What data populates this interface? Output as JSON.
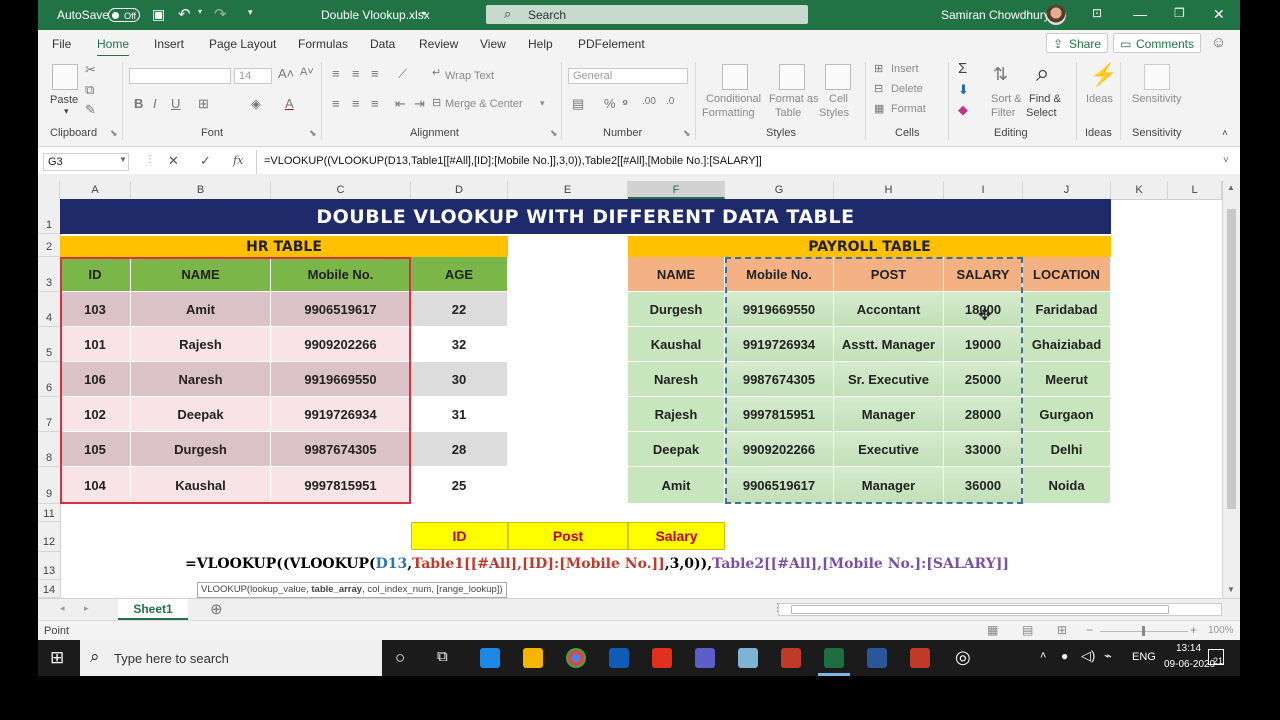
{
  "titlebar": {
    "autosave_label": "AutoSave",
    "autosave_state": "Off",
    "filename": "Double Vlookup.xlsx",
    "search_placeholder": "Search",
    "user_name": "Samiran Chowdhury"
  },
  "menu": {
    "tabs": [
      "File",
      "Home",
      "Insert",
      "Page Layout",
      "Formulas",
      "Data",
      "Review",
      "View",
      "Help",
      "PDFelement"
    ],
    "active": "Home",
    "share_label": "Share",
    "comments_label": "Comments"
  },
  "ribbon": {
    "clipboard": {
      "group": "Clipboard",
      "paste": "Paste"
    },
    "font": {
      "group": "Font",
      "size": "14"
    },
    "alignment": {
      "group": "Alignment",
      "wrap": "Wrap Text",
      "merge": "Merge & Center"
    },
    "number": {
      "group": "Number",
      "format": "General"
    },
    "styles": {
      "group": "Styles",
      "conditional1": "Conditional",
      "conditional2": "Formatting",
      "format_table1": "Format as",
      "format_table2": "Table",
      "cell_styles1": "Cell",
      "cell_styles2": "Styles"
    },
    "cells": {
      "group": "Cells",
      "insert": "Insert",
      "delete": "Delete",
      "format": "Format"
    },
    "editing": {
      "group": "Editing",
      "sort1": "Sort &",
      "sort2": "Filter",
      "find1": "Find &",
      "find2": "Select"
    },
    "ideas": {
      "group": "Ideas",
      "label": "Ideas"
    },
    "sensitivity": {
      "group": "Sensitivity",
      "label": "Sensitivity"
    }
  },
  "formula_bar": {
    "name_box": "G3",
    "fx": "fx",
    "formula": "=VLOOKUP((VLOOKUP(D13,Table1[[#All],[ID]:[Mobile No.]],3,0)),Table2[[#All],[Mobile No.]:[SALARY]]"
  },
  "columns": [
    "A",
    "B",
    "C",
    "D",
    "E",
    "F",
    "G",
    "H",
    "I",
    "J",
    "K",
    "L"
  ],
  "rows": [
    "1",
    "2",
    "3",
    "4",
    "5",
    "6",
    "7",
    "8",
    "9",
    "11",
    "12",
    "13",
    "14"
  ],
  "banner": "DOUBLE VLOOKUP WITH DIFFERENT DATA TABLE",
  "hr_table": {
    "title": "HR TABLE",
    "headers": [
      "ID",
      "NAME",
      "Mobile No.",
      "AGE"
    ],
    "rows": [
      [
        "103",
        "Amit",
        "9906519617",
        "22"
      ],
      [
        "101",
        "Rajesh",
        "9909202266",
        "32"
      ],
      [
        "106",
        "Naresh",
        "9919669550",
        "30"
      ],
      [
        "102",
        "Deepak",
        "9919726934",
        "31"
      ],
      [
        "105",
        "Durgesh",
        "9987674305",
        "28"
      ],
      [
        "104",
        "Kaushal",
        "9997815951",
        "25"
      ]
    ]
  },
  "payroll_table": {
    "title": "PAYROLL TABLE",
    "headers": [
      "NAME",
      "Mobile No.",
      "POST",
      "SALARY",
      "LOCATION"
    ],
    "rows": [
      [
        "Durgesh",
        "9919669550",
        "Accontant",
        "18000",
        "Faridabad"
      ],
      [
        "Kaushal",
        "9919726934",
        "Asstt. Manager",
        "19000",
        "Ghaiziabad"
      ],
      [
        "Naresh",
        "9987674305",
        "Sr. Executive",
        "25000",
        "Meerut"
      ],
      [
        "Rajesh",
        "9997815951",
        "Manager",
        "28000",
        "Gurgaon"
      ],
      [
        "Deepak",
        "9909202266",
        "Executive",
        "33000",
        "Delhi"
      ],
      [
        "Amit",
        "9906519617",
        "Manager",
        "36000",
        "Noida"
      ]
    ]
  },
  "lookup_headers": [
    "ID",
    "Post",
    "Salary"
  ],
  "cell_formula": {
    "p1": "=VLOOKUP((",
    "p2": "VLOOKUP(",
    "p3": "D13",
    "p4": ",",
    "p5": "Table1[[#All],[ID]:[Mobile No.]]",
    "p6": ",3,0))",
    "p7": ",",
    "p8": "Table2[[#All],[Mobile No.]:[SALARY]]"
  },
  "tooltip": {
    "fn": "VLOOKUP(lookup_value, ",
    "arg": "table_array",
    "rest": ", col_index_num, [range_lookup])"
  },
  "sheet_tab": "Sheet1",
  "status": {
    "mode": "Point",
    "zoom": "100%"
  },
  "taskbar": {
    "search_placeholder": "Type here to search",
    "lang": "ENG",
    "time": "13:14",
    "date": "09-06-2020",
    "notifications": "21"
  },
  "colors": {
    "excel_green": "#217346",
    "banner": "#1f2a6b",
    "section_yellow": "#ffc000",
    "hr_header": "#7ab648",
    "hr_row_odd": "#dbc2c9",
    "hr_row_even": "#f8e3e8",
    "payroll_header": "#f4b183",
    "payroll_row": "#c8e6be",
    "lookup_yellow": "#ffff00"
  }
}
